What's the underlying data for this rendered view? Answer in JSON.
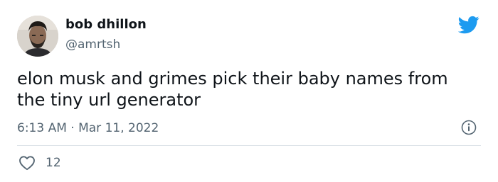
{
  "user": {
    "name": "bob dhillon",
    "handle": "@amrtsh"
  },
  "tweet": {
    "text": "elon musk and grimes pick their baby names from the tiny url generator",
    "timestamp": "6:13 AM · Mar 11, 2022",
    "likes": "12"
  },
  "icons": {
    "brand": "twitter-bird-icon",
    "info": "info-icon",
    "like": "heart-icon"
  },
  "colors": {
    "brand": "#1d9bf0",
    "text": "#0f1419",
    "secondary": "#536471",
    "divider": "#dde3e8"
  }
}
